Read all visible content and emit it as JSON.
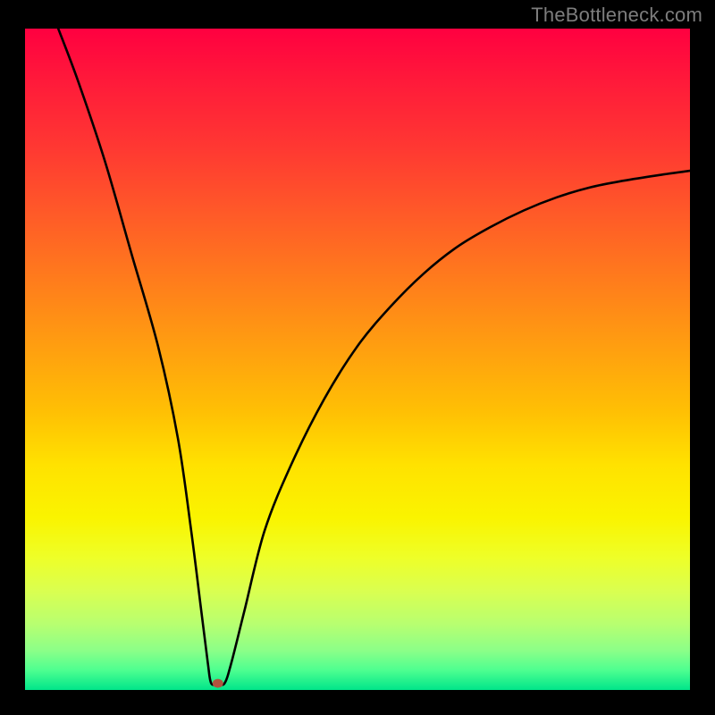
{
  "attribution": "TheBottleneck.com",
  "chart_data": {
    "type": "line",
    "title": "",
    "xlabel": "",
    "ylabel": "",
    "xlim": [
      0,
      100
    ],
    "ylim": [
      0,
      100
    ],
    "series": [
      {
        "name": "curve",
        "x": [
          5,
          8,
          12,
          16,
          20,
          23,
          25,
          26.5,
          27.5,
          28,
          29,
          30,
          31,
          33,
          36,
          40,
          45,
          50,
          55,
          60,
          65,
          70,
          75,
          80,
          85,
          90,
          95,
          100
        ],
        "values": [
          100,
          92,
          80,
          66,
          52,
          38,
          24,
          12,
          4,
          1,
          1,
          1,
          4,
          12,
          24,
          34,
          44,
          52,
          58,
          63,
          67,
          70,
          72.5,
          74.5,
          76,
          77,
          77.8,
          78.5
        ]
      }
    ],
    "marker": {
      "x": 29,
      "y": 1,
      "color": "#b1533e"
    },
    "background_gradient": {
      "top": "#ff0040",
      "mid": "#ffe200",
      "bottom": "#00e58a"
    }
  }
}
